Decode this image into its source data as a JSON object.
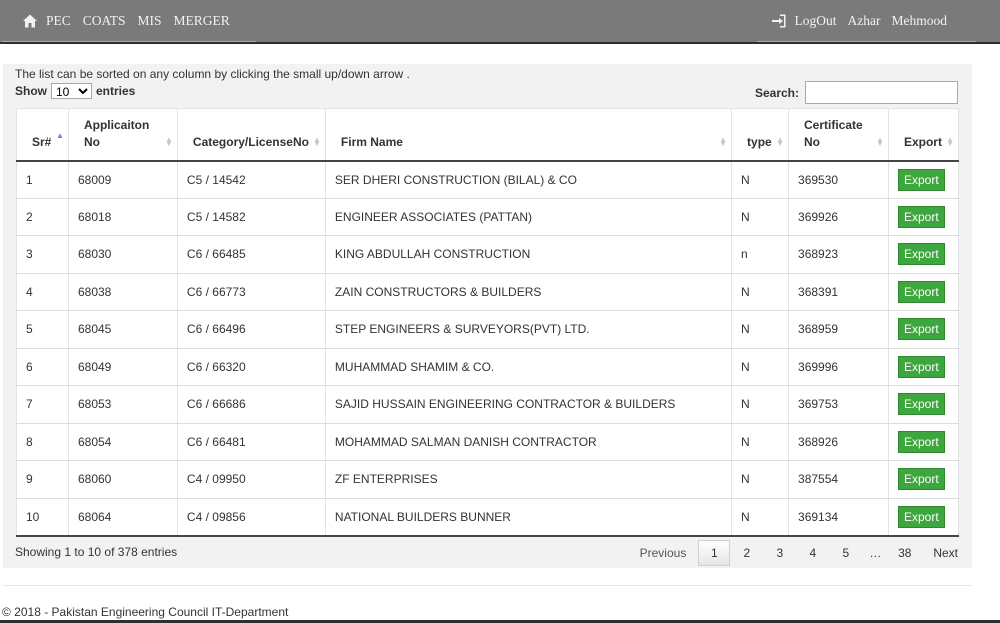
{
  "navbar": {
    "home_icon": "home-icon",
    "links": [
      "PEC",
      "COATS",
      "MIS",
      "MERGER"
    ],
    "logout_icon": "sign-out-icon",
    "logout_label": "LogOut",
    "user_first": "Azhar",
    "user_last": "Mehmood"
  },
  "table_controls": {
    "hint": "The list can be sorted on any column by clicking the small up/down arrow .",
    "show_label": "Show",
    "entries_label": "entries",
    "page_size": "10",
    "search_label": "Search:",
    "search_value": ""
  },
  "columns": [
    "Sr#",
    "Applicaiton No",
    "Category/LicenseNo",
    "Firm Name",
    "type",
    "Certificate No",
    "Export"
  ],
  "rows": [
    {
      "sr": "1",
      "app_no": "68009",
      "category": "C5 / 14542",
      "firm": "SER DHERI CONSTRUCTION (BILAL) & CO",
      "type": "N",
      "cert_no": "369530",
      "export": "Export"
    },
    {
      "sr": "2",
      "app_no": "68018",
      "category": "C5 / 14582",
      "firm": "ENGINEER ASSOCIATES (PATTAN)",
      "type": "N",
      "cert_no": "369926",
      "export": "Export"
    },
    {
      "sr": "3",
      "app_no": "68030",
      "category": "C6 / 66485",
      "firm": "KING ABDULLAH CONSTRUCTION",
      "type": "n",
      "cert_no": "368923",
      "export": "Export"
    },
    {
      "sr": "4",
      "app_no": "68038",
      "category": "C6 / 66773",
      "firm": "ZAIN CONSTRUCTORS & BUILDERS",
      "type": "N",
      "cert_no": "368391",
      "export": "Export"
    },
    {
      "sr": "5",
      "app_no": "68045",
      "category": "C6 / 66496",
      "firm": "STEP ENGINEERS & SURVEYORS(PVT) LTD.",
      "type": "N",
      "cert_no": "368959",
      "export": "Export"
    },
    {
      "sr": "6",
      "app_no": "68049",
      "category": "C6 / 66320",
      "firm": "MUHAMMAD SHAMIM & CO.",
      "type": "N",
      "cert_no": "369996",
      "export": "Export"
    },
    {
      "sr": "7",
      "app_no": "68053",
      "category": "C6 / 66686",
      "firm": "SAJID HUSSAIN ENGINEERING CONTRACTOR & BUILDERS",
      "type": "N",
      "cert_no": "369753",
      "export": "Export"
    },
    {
      "sr": "8",
      "app_no": "68054",
      "category": "C6 / 66481",
      "firm": "MOHAMMAD SALMAN DANISH CONTRACTOR",
      "type": "N",
      "cert_no": "368926",
      "export": "Export"
    },
    {
      "sr": "9",
      "app_no": "68060",
      "category": "C4 / 09950",
      "firm": "ZF ENTERPRISES",
      "type": "N",
      "cert_no": "387554",
      "export": "Export"
    },
    {
      "sr": "10",
      "app_no": "68064",
      "category": "C4 / 09856",
      "firm": "NATIONAL BUILDERS BUNNER",
      "type": "N",
      "cert_no": "369134",
      "export": "Export"
    }
  ],
  "pagination": {
    "info": "Showing 1 to 10 of 378 entries",
    "previous": "Previous",
    "pages": [
      "1",
      "2",
      "3",
      "4",
      "5"
    ],
    "current": "1",
    "ellipsis": "…",
    "last": "38",
    "next": "Next"
  },
  "footer": {
    "text": "© 2018 - Pakistan Engineering Council IT-Department"
  },
  "colors": {
    "navbar_bg": "#7a7a7a",
    "export_button": "#3ea63e",
    "sort_active": "#7b7bd6"
  }
}
